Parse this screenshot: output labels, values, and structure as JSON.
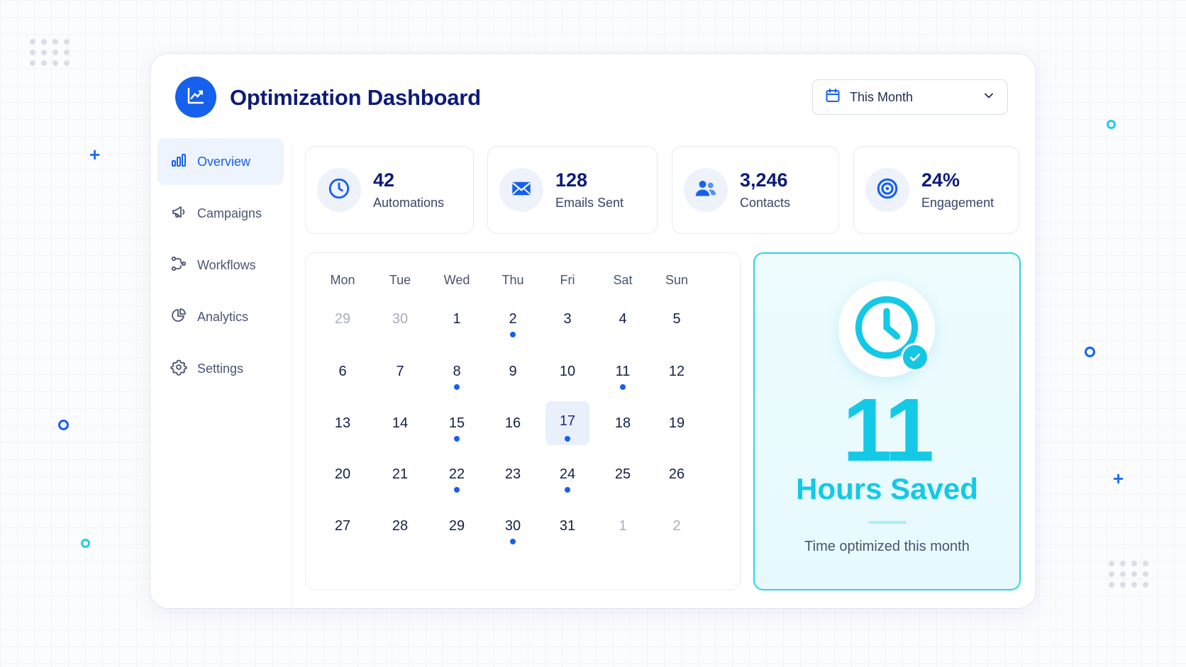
{
  "header": {
    "title": "Optimization Dashboard",
    "range_select": {
      "value": "This Month",
      "icon": "calendar-icon"
    }
  },
  "sidebar": {
    "items": [
      {
        "label": "Overview",
        "icon": "bar-chart-icon",
        "active": true
      },
      {
        "label": "Campaigns",
        "icon": "megaphone-icon",
        "active": false
      },
      {
        "label": "Workflows",
        "icon": "workflow-icon",
        "active": false
      },
      {
        "label": "Analytics",
        "icon": "pie-chart-icon",
        "active": false
      },
      {
        "label": "Settings",
        "icon": "gear-icon",
        "active": false
      }
    ]
  },
  "stats": [
    {
      "value": "42",
      "label": "Automations",
      "icon": "clock-icon"
    },
    {
      "value": "128",
      "label": "Emails Sent",
      "icon": "envelope-icon"
    },
    {
      "value": "3,246",
      "label": "Contacts",
      "icon": "users-icon"
    },
    {
      "value": "24%",
      "label": "Engagement",
      "icon": "target-icon"
    }
  ],
  "calendar": {
    "weekdays": [
      "Mon",
      "Tue",
      "Wed",
      "Thu",
      "Fri",
      "Sat",
      "Sun"
    ],
    "weeks": [
      [
        {
          "day": "29",
          "muted": true
        },
        {
          "day": "30",
          "muted": true
        },
        {
          "day": "1"
        },
        {
          "day": "2",
          "event": true
        },
        {
          "day": "3"
        },
        {
          "day": "4"
        },
        {
          "day": "5"
        }
      ],
      [
        {
          "day": "6"
        },
        {
          "day": "7"
        },
        {
          "day": "8",
          "event": true
        },
        {
          "day": "9"
        },
        {
          "day": "10"
        },
        {
          "day": "11",
          "event": true
        },
        {
          "day": "12"
        }
      ],
      [
        {
          "day": "13"
        },
        {
          "day": "14"
        },
        {
          "day": "15",
          "event": true
        },
        {
          "day": "16"
        },
        {
          "day": "17",
          "event": true,
          "today": true
        },
        {
          "day": "18"
        },
        {
          "day": "19"
        }
      ],
      [
        {
          "day": "20"
        },
        {
          "day": "21"
        },
        {
          "day": "22",
          "event": true
        },
        {
          "day": "23"
        },
        {
          "day": "24",
          "event": true
        },
        {
          "day": "25"
        },
        {
          "day": "26"
        }
      ],
      [
        {
          "day": "27"
        },
        {
          "day": "28"
        },
        {
          "day": "29"
        },
        {
          "day": "30",
          "event": true
        },
        {
          "day": "31"
        },
        {
          "day": "1",
          "muted": true
        },
        {
          "day": "2",
          "muted": true
        }
      ]
    ]
  },
  "hours_saved": {
    "value": "11",
    "title": "Hours Saved",
    "subtitle": "Time optimized this month",
    "icon": "clock-check-icon"
  },
  "colors": {
    "primary": "#1660ee",
    "navy": "#0d1b78",
    "accent": "#14c9e6"
  }
}
